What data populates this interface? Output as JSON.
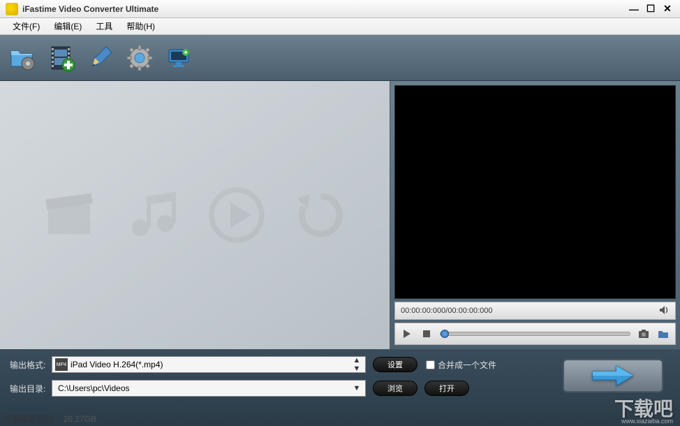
{
  "titlebar": {
    "title": "iFastime Video Converter Ultimate"
  },
  "menu": {
    "file": "文件(F)",
    "edit": "编辑(E)",
    "tools": "工具",
    "help": "帮助(H)"
  },
  "toolbar": {
    "icons": {
      "load_file": "load-file-icon",
      "load_video": "load-video-icon",
      "edit": "edit-icon",
      "settings": "settings-icon",
      "display": "display-icon"
    }
  },
  "preview": {
    "time": "00:00:00:000/00:00:00:000"
  },
  "output": {
    "format_label": "输出格式:",
    "format_value": "iPad Video H.264(*.mp4)",
    "format_icon_text": "MP4",
    "settings_btn": "设置",
    "merge_label": "合并成一个文件",
    "dir_label": "输出目录:",
    "dir_value": "C:\\Users\\pc\\Videos",
    "browse_btn": "浏览",
    "open_btn": "打开"
  },
  "disk": {
    "label": "可用磁盘空间:",
    "value": "20.27GB"
  },
  "brand": {
    "text": "下载吧",
    "url": "www.xiazaiba.com"
  }
}
